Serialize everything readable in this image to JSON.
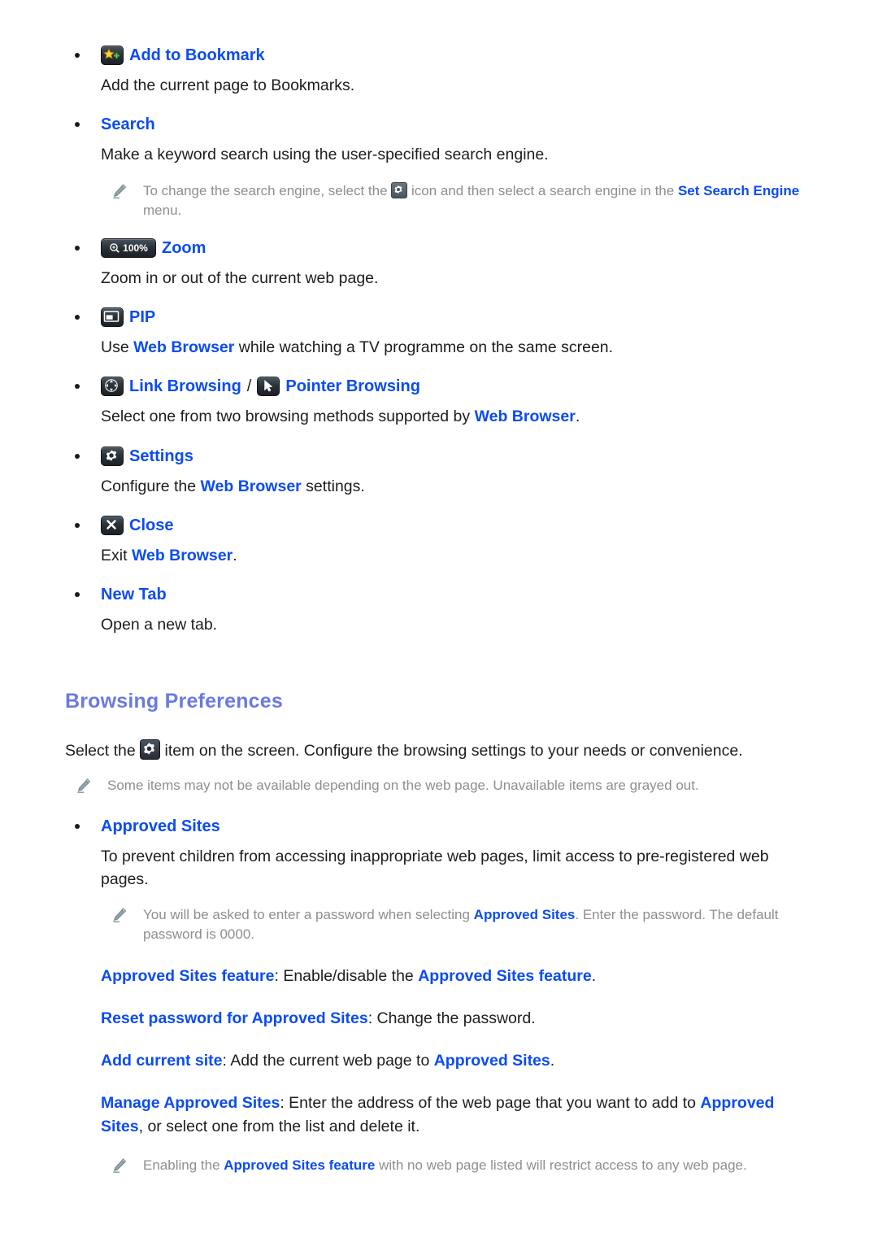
{
  "page": {
    "features": [
      {
        "id": "add-to-bookmark",
        "icon": "bookmark-add-icon",
        "title": "Add to Bookmark",
        "body": "Add the current page to Bookmarks."
      },
      {
        "id": "search",
        "icon": "",
        "title": "Search",
        "body": "Make a keyword search using the user-specified search engine."
      },
      {
        "id": "zoom",
        "icon": "zoom-100-icon",
        "icon_label": "100%",
        "title": "Zoom",
        "body": "Zoom in or out of the current web page."
      },
      {
        "id": "pip",
        "icon": "pip-icon",
        "title": "PIP",
        "body_prefix": "Use ",
        "body_link": "Web Browser",
        "body_suffix": " while watching a TV programme on the same screen."
      },
      {
        "id": "link-pointer-browsing",
        "icon": "dpad-icon",
        "title": "Link Browsing",
        "separator": "/",
        "icon2": "pointer-icon",
        "title2": "Pointer Browsing",
        "body_prefix": "Select one from two browsing methods supported by ",
        "body_link": "Web Browser",
        "body_suffix": "."
      },
      {
        "id": "settings",
        "icon": "gear-icon",
        "title": "Settings",
        "body_prefix": "Configure the ",
        "body_link": "Web Browser",
        "body_suffix": " settings."
      },
      {
        "id": "close",
        "icon": "close-x-icon",
        "title": "Close",
        "body_prefix": "Exit ",
        "body_link": "Web Browser",
        "body_suffix": "."
      },
      {
        "id": "new-tab",
        "icon": "",
        "title": "New Tab",
        "body": "Open a new tab."
      }
    ],
    "search_note": {
      "part1": "To change the search engine, select the ",
      "part2": " icon and then select a search engine in the ",
      "link": "Set Search Engine",
      "part3": " menu."
    },
    "section": {
      "heading": "Browsing Preferences",
      "intro_part1": "Select the ",
      "intro_part2": " item on the screen. Configure the browsing settings to your needs or convenience.",
      "intro_note": "Some items may not be available depending on the web page. Unavailable items are grayed out."
    },
    "approved_sites": {
      "title": "Approved Sites",
      "body": "To prevent children from accessing inappropriate web pages, limit access to pre-registered web pages.",
      "note_part1": "You will be asked to enter a password when selecting ",
      "note_link": "Approved Sites",
      "note_part2": ". Enter the password. The default password is 0000.",
      "items": [
        {
          "label": "Approved Sites feature",
          "text_part1": ": Enable/disable the ",
          "link": "Approved Sites feature",
          "text_part2": "."
        },
        {
          "label": "Reset password for Approved Sites",
          "text_part1": ": Change the password.",
          "link": "",
          "text_part2": ""
        },
        {
          "label": "Add current site",
          "text_part1": ": Add the current web page to ",
          "link": "Approved Sites",
          "text_part2": "."
        },
        {
          "label": "Manage Approved Sites",
          "text_part1": ": Enter the address of the web page that you want to add to ",
          "link": "Approved Sites",
          "text_part2": ", or select one from the list and delete it."
        }
      ],
      "footer_note_part1": "Enabling the ",
      "footer_note_link": "Approved Sites feature",
      "footer_note_part2": " with no web page listed will restrict access to any web page."
    },
    "colors": {
      "link_blue": "#0b4cf0",
      "heading_blue": "#6a7ae0",
      "note_gray": "#8e8e8e",
      "body_black": "#1d1d1d"
    }
  }
}
